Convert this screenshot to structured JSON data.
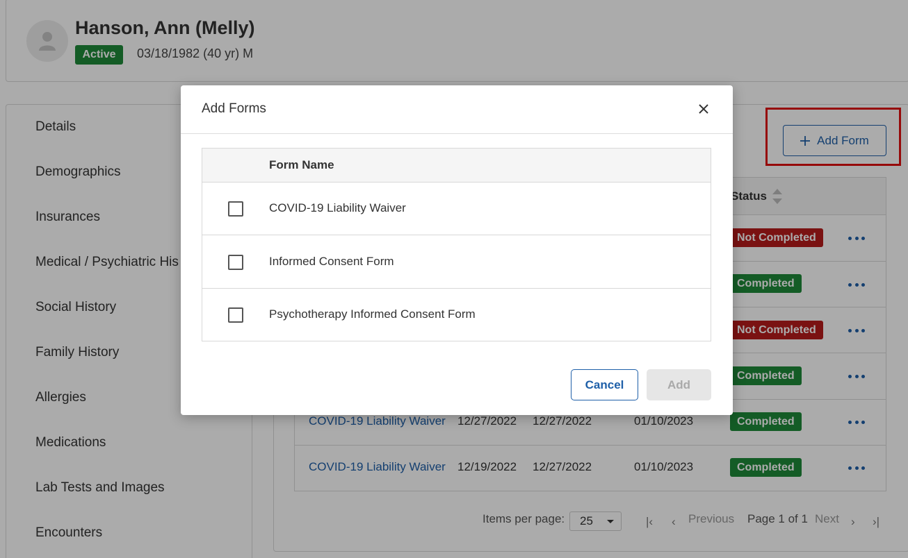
{
  "patient": {
    "name": "Hanson, Ann (Melly)",
    "status": "Active",
    "dob": "03/18/1982 (40 yr) M"
  },
  "sidebar": {
    "items": [
      {
        "label": "Details"
      },
      {
        "label": "Demographics"
      },
      {
        "label": "Insurances"
      },
      {
        "label": "Medical / Psychiatric His"
      },
      {
        "label": "Social History"
      },
      {
        "label": "Family History"
      },
      {
        "label": "Allergies"
      },
      {
        "label": "Medications"
      },
      {
        "label": "Lab Tests and Images"
      },
      {
        "label": "Encounters"
      }
    ]
  },
  "toolbar": {
    "add_form_label": "Add Form"
  },
  "table": {
    "status_header": "Status",
    "rows": [
      {
        "status": "Not Completed",
        "status_color": "#b71c1c"
      },
      {
        "status": "Completed",
        "status_color": "#1f8a3a"
      },
      {
        "status": "Not Completed",
        "status_color": "#b71c1c"
      },
      {
        "status": "Completed",
        "status_color": "#1f8a3a"
      },
      {
        "form": "COVID-19 Liability Waiver",
        "date1": "12/27/2022",
        "date2": "12/27/2022",
        "date3": "01/10/2023",
        "status": "Completed",
        "status_color": "#1f8a3a"
      },
      {
        "form": "COVID-19 Liability Waiver",
        "date1": "12/19/2022",
        "date2": "12/27/2022",
        "date3": "01/10/2023",
        "status": "Completed",
        "status_color": "#1f8a3a"
      }
    ]
  },
  "pagination": {
    "items_per_page_label": "Items per page:",
    "items_per_page_value": "25",
    "previous_label": "Previous",
    "page_info": "Page 1 of 1",
    "next_label": "Next"
  },
  "modal": {
    "title": "Add Forms",
    "column_header": "Form Name",
    "forms": [
      {
        "name": "COVID-19 Liability Waiver"
      },
      {
        "name": "Informed Consent Form"
      },
      {
        "name": "Psychotherapy Informed Consent Form"
      }
    ],
    "cancel_label": "Cancel",
    "add_label": "Add"
  },
  "colors": {
    "accent": "#1e5fa8",
    "success": "#1f8a3a",
    "danger": "#b71c1c",
    "highlight": "#e01010"
  }
}
